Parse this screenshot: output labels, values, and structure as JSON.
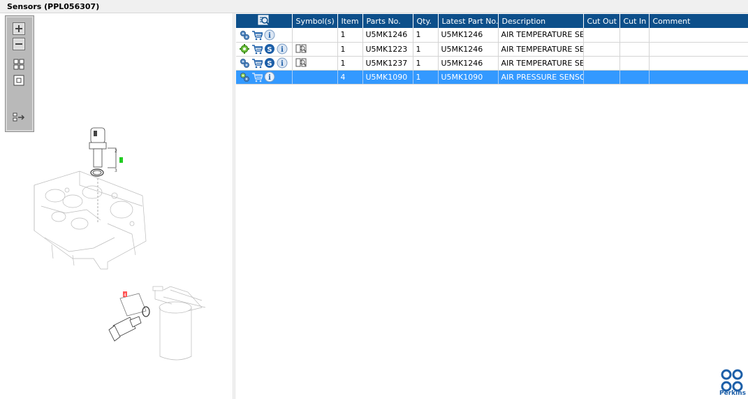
{
  "window": {
    "title": "Sensors (PPL056307)"
  },
  "toolbox": {
    "buttons": [
      {
        "name": "zoom-in-icon"
      },
      {
        "name": "zoom-out-icon"
      },
      {
        "name": "fit-all-icon"
      },
      {
        "name": "fit-window-icon"
      },
      {
        "name": "toggle-panel-icon"
      }
    ]
  },
  "drawing": {
    "callout_1": "1",
    "callout_2": "2",
    "callout_3": "3",
    "callout_4": "4"
  },
  "table": {
    "headers": [
      "",
      "Symbol(s)",
      "Item",
      "Parts No.",
      "Qty.",
      "Latest Part No.",
      "Description",
      "Cut Out",
      "Cut In",
      "Comment"
    ],
    "rows": [
      {
        "item": "1",
        "part_no": "U5MK1246",
        "qty": "1",
        "latest": "U5MK1246",
        "description": "AIR TEMPERATURE SENSOR",
        "cut_out": "",
        "cut_in": "",
        "comment": "",
        "icons": [
          "gears-icon",
          "cart-icon",
          "info-icon"
        ],
        "symbol": ""
      },
      {
        "item": "1",
        "part_no": "U5MK1223",
        "qty": "1",
        "latest": "U5MK1246",
        "description": "AIR TEMPERATURE SENSOR",
        "cut_out": "",
        "cut_in": "",
        "comment": "",
        "icons": [
          "gear-icon",
          "cart-icon",
          "supersession-icon",
          "info-icon"
        ],
        "symbol": "book-icon"
      },
      {
        "item": "1",
        "part_no": "U5MK1237",
        "qty": "1",
        "latest": "U5MK1246",
        "description": "AIR TEMPERATURE SENSOR",
        "cut_out": "",
        "cut_in": "",
        "comment": "",
        "icons": [
          "gears-icon",
          "cart-icon",
          "supersession-icon",
          "info-icon"
        ],
        "symbol": "book-icon"
      },
      {
        "item": "4",
        "part_no": "U5MK1090",
        "qty": "1",
        "latest": "U5MK1090",
        "description": "AIR PRESSURE SENSOR",
        "cut_out": "",
        "cut_in": "",
        "comment": "",
        "icons": [
          "gears-icon",
          "cart-icon",
          "info-icon"
        ],
        "symbol": "",
        "selected": true
      }
    ]
  },
  "brand": {
    "name": "Perkins",
    "color": "#1d5fa8"
  },
  "colors": {
    "header": "#0d4f8a",
    "selection": "#3399ff"
  }
}
